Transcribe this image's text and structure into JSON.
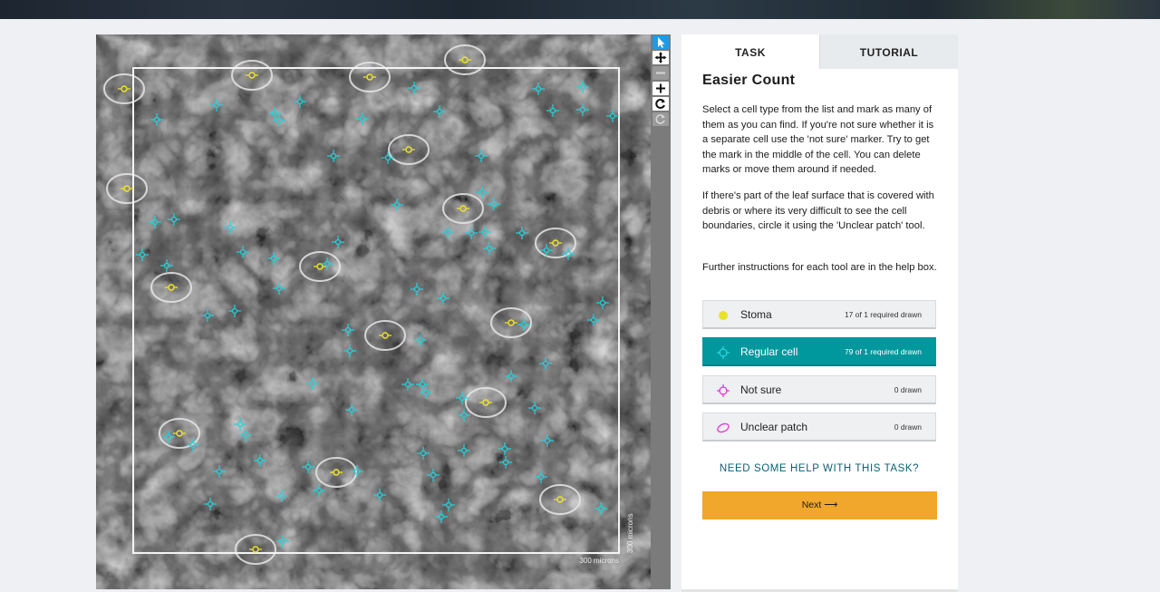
{
  "toolbar": {
    "select_icon": "pointer-icon",
    "pan_icon": "move-icon",
    "zoom_out_icon": "minus-icon",
    "zoom_in_icon": "plus-icon",
    "rotate_icon": "rotate-icon",
    "reset_icon": "refresh-icon"
  },
  "image": {
    "scale_label": "300 microns",
    "scale_label_vertical": "300 microns"
  },
  "panel": {
    "tabs": [
      {
        "label": "TASK",
        "active": true
      },
      {
        "label": "TUTORIAL",
        "active": false
      }
    ],
    "title": "Easier Count",
    "paragraphs": [
      "Select a cell type from the list and mark as many of them as you can find. If you're not sure whether it is a separate cell use the 'not sure' marker. Try to get the mark in the middle of the cell. You can delete marks or move them around if needed.",
      "If there's part of the leaf surface that is covered with debris or where its very difficult to see the cell boundaries, circle it using the 'Unclear patch' tool.",
      "Further instructions for each tool are in the help box."
    ],
    "tools": [
      {
        "label": "Stoma",
        "count": "17 of 1 required drawn",
        "icon": "yellow-dot-icon",
        "color": "#e8e22a",
        "selected": false
      },
      {
        "label": "Regular cell",
        "count": "79 of 1 required drawn",
        "icon": "crosshair-icon",
        "color": "#29d3df",
        "selected": true
      },
      {
        "label": "Not sure",
        "count": "0 drawn",
        "icon": "crosshair-icon",
        "color": "#e23bd1",
        "selected": false
      },
      {
        "label": "Unclear patch",
        "count": "0 drawn",
        "icon": "ellipse-icon",
        "color": "#e23bd1",
        "selected": false
      }
    ],
    "help_link": "NEED SOME HELP WITH THIS TASK?",
    "next_label": "Next ⟶"
  }
}
